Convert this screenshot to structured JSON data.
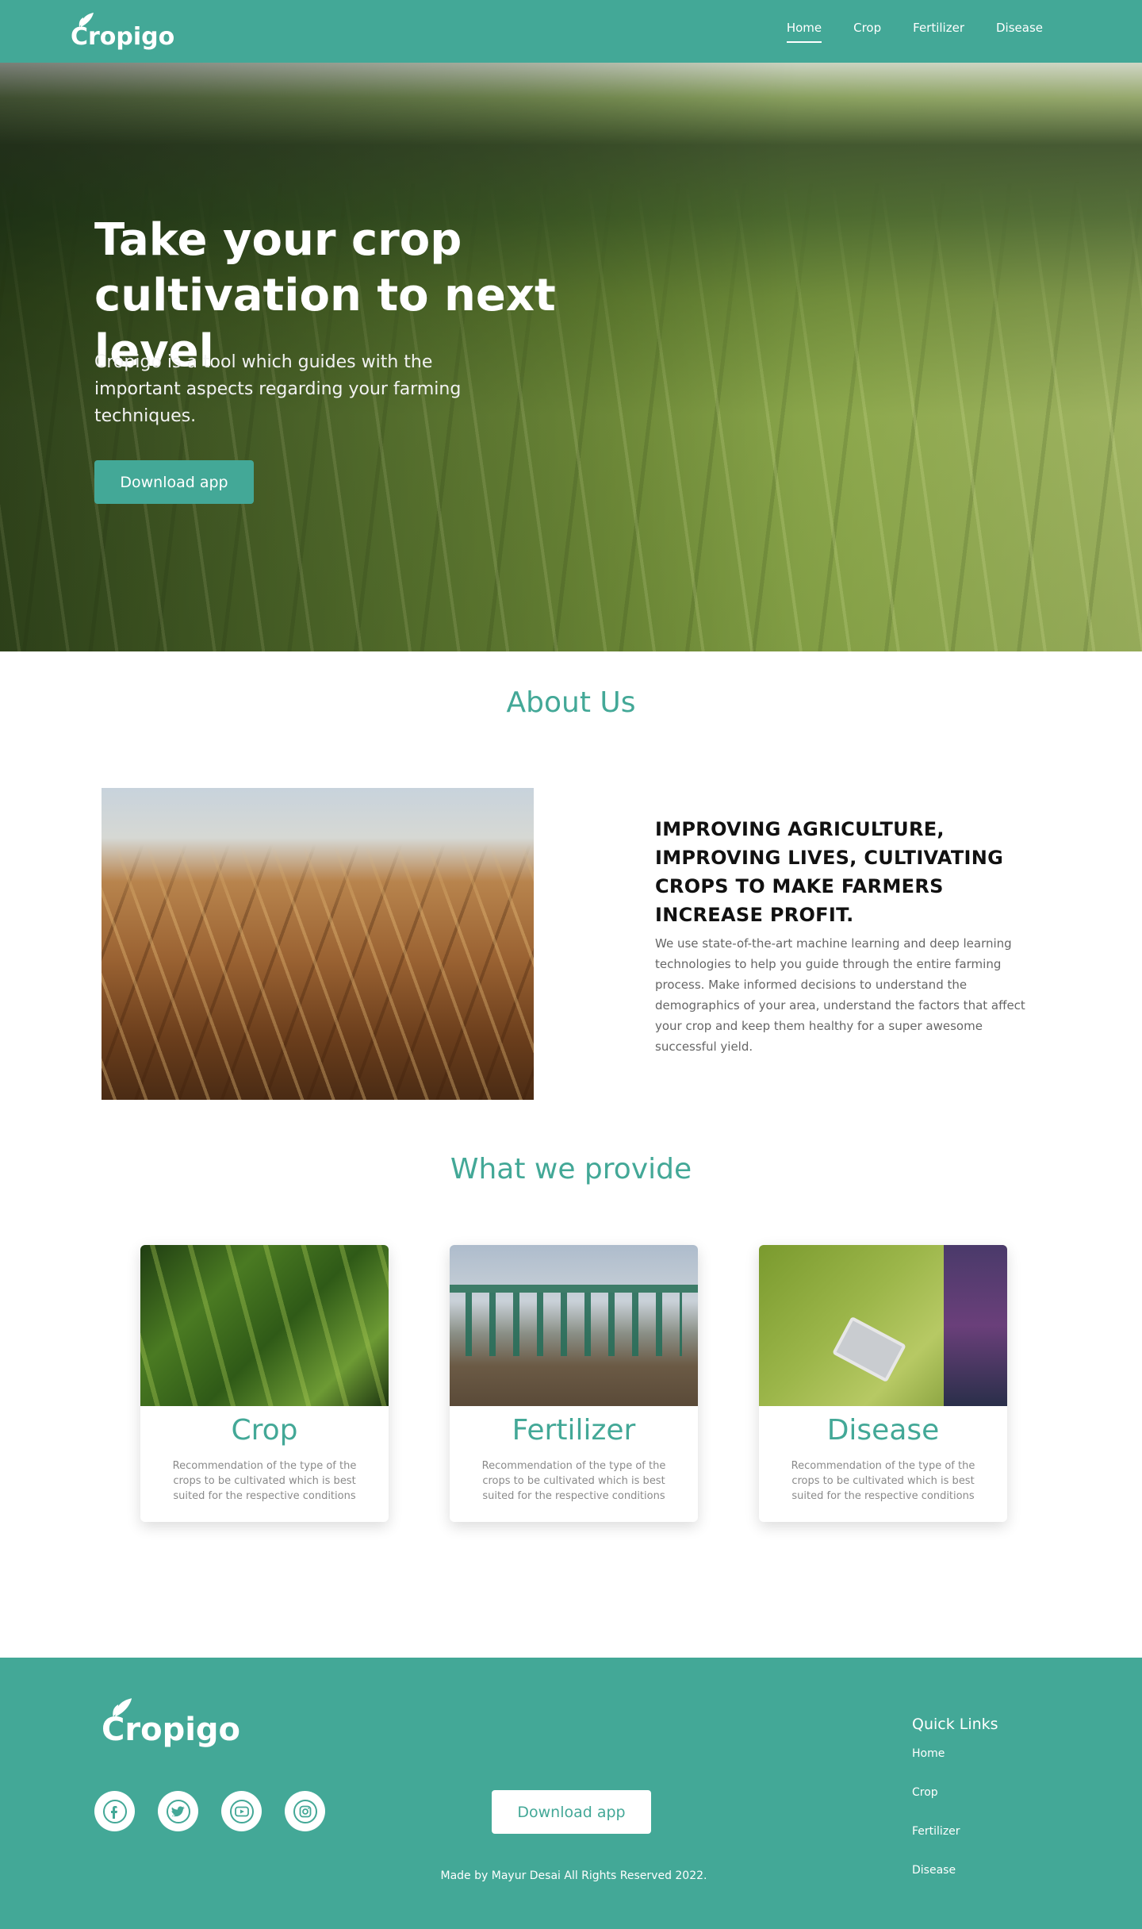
{
  "brand": {
    "name": "Cropigo",
    "primary_color": "#43a897",
    "text_on_primary": "#ffffff"
  },
  "nav": {
    "items": [
      {
        "label": "Home",
        "active": true
      },
      {
        "label": "Crop",
        "active": false
      },
      {
        "label": "Fertilizer",
        "active": false
      },
      {
        "label": "Disease",
        "active": false
      }
    ]
  },
  "hero": {
    "title_line1": "Take your crop",
    "title_line2": "cultivation to next level",
    "subtitle": "Cropigo is a tool which guides with the important aspects regarding your farming techniques.",
    "cta_label": "Download app"
  },
  "about": {
    "title": "About Us",
    "heading": "IMPROVING AGRICULTURE, IMPROVING LIVES, CULTIVATING CROPS TO MAKE FARMERS INCREASE PROFIT.",
    "text": "We use state-of-the-art machine learning and deep learning technologies to help you guide through the entire farming process. Make informed decisions to understand the demographics of your area, understand the factors that affect your crop and keep them healthy for a super awesome successful yield."
  },
  "provide": {
    "title": "What we provide",
    "cards": [
      {
        "title": "Crop",
        "description": "Recommendation of the type of the crops to be cultivated which is best suited for the respective conditions"
      },
      {
        "title": "Fertilizer",
        "description": "Recommendation of the type of the crops to be cultivated which is best suited for the respective conditions"
      },
      {
        "title": "Disease",
        "description": "Recommendation of the type of the crops to be cultivated which is best suited for the respective conditions"
      }
    ]
  },
  "footer": {
    "logo": "Cropigo",
    "socials": [
      {
        "icon": "facebook-icon"
      },
      {
        "icon": "twitter-icon"
      },
      {
        "icon": "youtube-icon"
      },
      {
        "icon": "instagram-icon"
      }
    ],
    "cta_label": "Download app",
    "copyright": "Made by Mayur Desai All Rights Reserved 2022.",
    "quick_links": {
      "title": "Quick Links",
      "items": [
        "Home",
        "Crop",
        "Fertilizer",
        "Disease"
      ]
    }
  }
}
